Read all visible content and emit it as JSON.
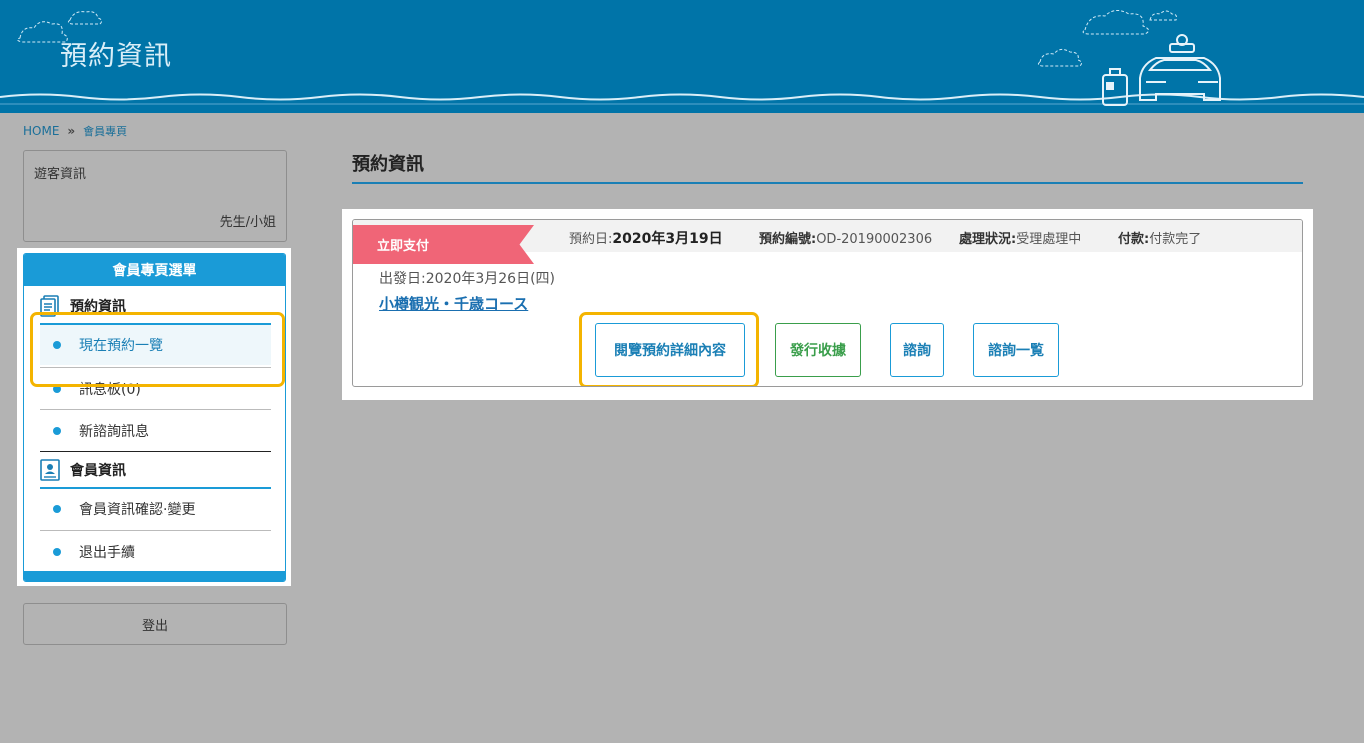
{
  "header": {
    "title": "預約資訊"
  },
  "breadcrumb": {
    "home": "HOME",
    "separator": "»",
    "current": "會員專頁"
  },
  "guest": {
    "label": "遊客資訊",
    "suffix": "先生/小姐"
  },
  "menu": {
    "title": "會員專頁選單",
    "sections": [
      {
        "label": "預約資訊",
        "icon": "document-icon",
        "items": [
          {
            "label": "現在預約一覽",
            "active": true
          },
          {
            "label": "訊息板(0)"
          },
          {
            "label": "新諮詢訊息"
          }
        ]
      },
      {
        "label": "會員資訊",
        "icon": "id-card-icon",
        "items": [
          {
            "label": "會員資訊確認·變更"
          },
          {
            "label": "退出手續"
          }
        ]
      }
    ]
  },
  "logout_label": "登出",
  "main": {
    "title": "預約資訊",
    "booking": {
      "badge": "立即支付",
      "date_label": "預約日:",
      "date_value": "2020年3月19日",
      "number_label": "預約編號:",
      "number_value": "OD-20190002306",
      "status_label": "處理狀況:",
      "status_value": "受理處理中",
      "payment_label": "付款:",
      "payment_value": "付款完了",
      "depart": "出發日:2020年3月26日(四)",
      "course": "小樽観光・千歳コース",
      "buttons": {
        "detail": "閱覽預約詳細內容",
        "receipt": "發行收據",
        "inquiry": "諮詢",
        "inquiry_list": "諮詢一覧"
      }
    }
  },
  "colors": {
    "header_bg": "#0074a8",
    "accent": "#1a9bd7",
    "badge": "#f06577",
    "highlight": "#f4b400",
    "receipt_green": "#3a9e4b"
  }
}
